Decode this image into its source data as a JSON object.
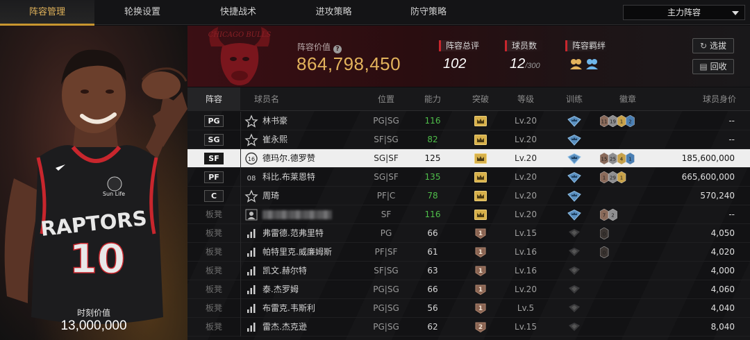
{
  "nav": {
    "tabs": [
      "阵容管理",
      "轮换设置",
      "快捷战术",
      "进攻策略",
      "防守策略"
    ],
    "active_tab": "阵容管理",
    "lineup_select": "主力阵容"
  },
  "player_card": {
    "jersey_team": "RAPTORS",
    "jersey_number": "10",
    "sponsor": "Sun Life",
    "moment_value_label": "时刻价值",
    "moment_value": "13,000,000"
  },
  "summary": {
    "team_logo_text": "CHICAGO BULLS",
    "lineup_value_label": "阵容价值",
    "lineup_value": "864,798,450",
    "overall_label": "阵容总评",
    "overall_value": "102",
    "players_label": "球员数",
    "players_value": "12",
    "players_max": "/300",
    "bond_label": "阵容羁绊",
    "pick_button": "选拔",
    "recycle_button": "回收"
  },
  "table": {
    "headers": [
      "阵容",
      "球员名",
      "位置",
      "能力",
      "突破",
      "等级",
      "训练",
      "徽章",
      "球员身价"
    ],
    "rows": [
      {
        "slot": "PG",
        "icon": "star",
        "name": "林书豪",
        "pos": "PG|SG",
        "ability": "116",
        "ability_color": "green",
        "break": "crown-gold",
        "level": "Lv.20",
        "train": "crown-blue",
        "badges": [
          "11",
          "19",
          "1",
          "2"
        ],
        "worth": "--"
      },
      {
        "slot": "SG",
        "icon": "star",
        "name": "崔永熙",
        "pos": "SF|SG",
        "ability": "82",
        "ability_color": "green",
        "break": "crown-gold",
        "level": "Lv.20",
        "train": "crown-blue",
        "badges": [],
        "worth": "--"
      },
      {
        "slot": "SF",
        "icon": "moment-16",
        "name": "德玛尔.德罗赞",
        "pos": "SG|SF",
        "ability": "125",
        "ability_color": "white",
        "break": "crown-gold",
        "level": "Lv.20",
        "train": "crown-blue",
        "badges": [
          "15",
          "25",
          "4",
          "1"
        ],
        "worth": "185,600,000",
        "selected": true
      },
      {
        "slot": "PF",
        "icon": "number-08",
        "name": "科比.布莱恩特",
        "pos": "SG|SF",
        "ability": "135",
        "ability_color": "green",
        "break": "crown-gold",
        "level": "Lv.20",
        "train": "crown-blue",
        "badges": [
          "1",
          "29",
          "1"
        ],
        "worth": "665,600,000"
      },
      {
        "slot": "C",
        "icon": "star",
        "name": "周琦",
        "pos": "PF|C",
        "ability": "78",
        "ability_color": "green",
        "break": "crown-gold",
        "level": "Lv.20",
        "train": "crown-blue",
        "badges": [],
        "worth": "570,240"
      },
      {
        "slot": "板凳",
        "icon": "avatar",
        "name": "",
        "pos": "SF",
        "ability": "116",
        "ability_color": "green",
        "break": "crown-gold",
        "level": "Lv.20",
        "train": "crown-blue",
        "badges": [
          "7",
          "2"
        ],
        "worth": "--",
        "blurred": true
      },
      {
        "slot": "板凳",
        "icon": "bars",
        "name": "弗雷德.范弗里特",
        "pos": "PG",
        "ability": "66",
        "ability_color": "white",
        "break": "rank-1",
        "level": "Lv.15",
        "train": "crown-dim",
        "badges": [
          "0"
        ],
        "worth": "4,050"
      },
      {
        "slot": "板凳",
        "icon": "bars",
        "name": "帕特里克.威廉姆斯",
        "pos": "PF|SF",
        "ability": "61",
        "ability_color": "white",
        "break": "rank-1",
        "level": "Lv.16",
        "train": "crown-dim",
        "badges": [
          "0"
        ],
        "worth": "4,020"
      },
      {
        "slot": "板凳",
        "icon": "bars",
        "name": "凯文.赫尔特",
        "pos": "SF|SG",
        "ability": "63",
        "ability_color": "white",
        "break": "rank-1",
        "level": "Lv.16",
        "train": "crown-dim",
        "badges": [],
        "worth": "4,000"
      },
      {
        "slot": "板凳",
        "icon": "bars",
        "name": "泰.杰罗姆",
        "pos": "PG|SG",
        "ability": "66",
        "ability_color": "white",
        "break": "rank-1",
        "level": "Lv.20",
        "train": "crown-dim",
        "badges": [],
        "worth": "4,060"
      },
      {
        "slot": "板凳",
        "icon": "bars",
        "name": "布雷克.韦斯利",
        "pos": "PG|SG",
        "ability": "56",
        "ability_color": "white",
        "break": "rank-1",
        "level": "Lv.5",
        "train": "crown-dim",
        "badges": [],
        "worth": "4,040"
      },
      {
        "slot": "板凳",
        "icon": "bars",
        "name": "雷杰.杰克逊",
        "pos": "PG|SG",
        "ability": "62",
        "ability_color": "white",
        "break": "rank-2",
        "level": "Lv.15",
        "train": "crown-dim",
        "badges": [],
        "worth": "8,040"
      }
    ]
  },
  "colors": {
    "accent_gold": "#e3b35c",
    "ability_green": "#4fbf4a",
    "team_red": "#c8262d"
  }
}
